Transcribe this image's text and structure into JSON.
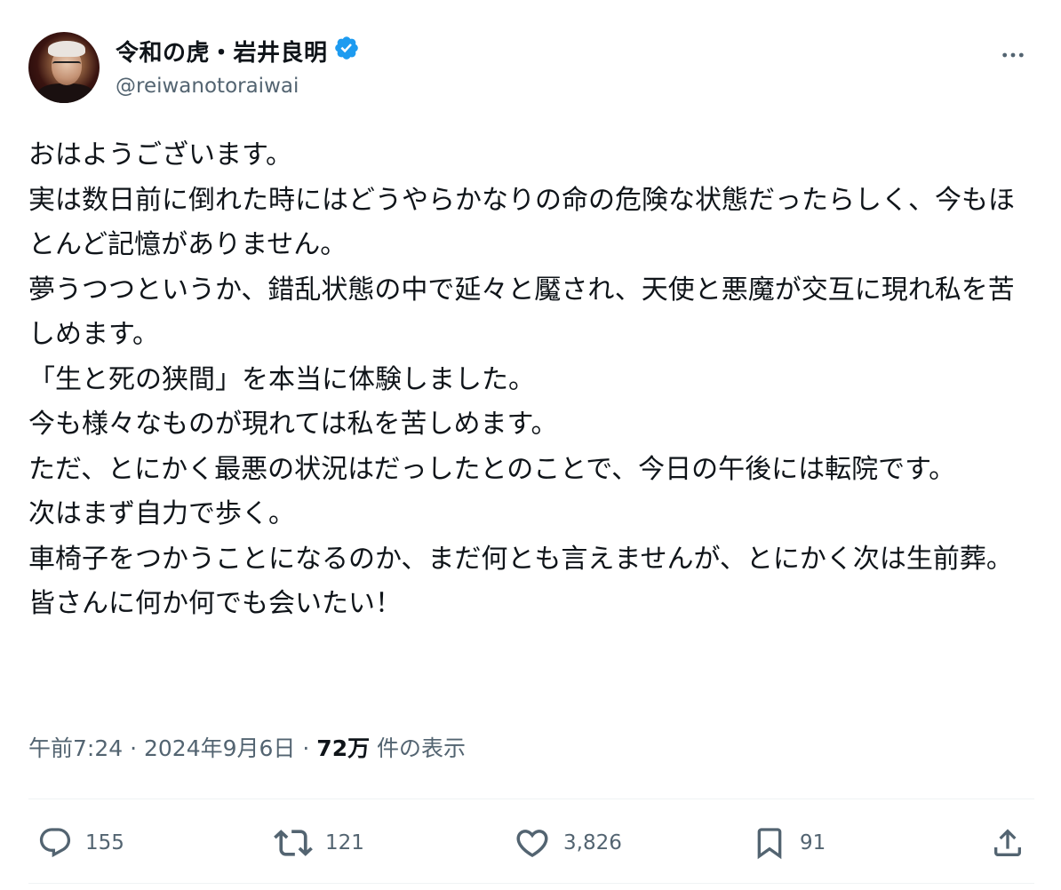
{
  "author": {
    "display_name": "令和の虎・岩井良明",
    "handle": "@reiwanotoraiwai",
    "verified": true
  },
  "tweet": {
    "text": "おはようございます。\n実は数日前に倒れた時にはどうやらかなりの命の危険な状態だったらしく、今もほとんど記憶がありません。\n夢うつつというか、錯乱状態の中で延々と魘され、天使と悪魔が交互に現れ私を苦しめます。\n「生と死の狭間」を本当に体験しました。\n今も様々なものが現れては私を苦しめます。\nただ、とにかく最悪の状況はだっしたとのことで、今日の午後には転院です。\n次はまず自力で歩く。\n車椅子をつかうことになるのか、まだ何とも言えませんが、とにかく次は生前葬。\n皆さんに何か何でも会いたい！"
  },
  "meta": {
    "time": "午前7:24",
    "separator": "·",
    "date": "2024年9月6日",
    "views_count": "72万",
    "views_label": "件の表示"
  },
  "actions": {
    "reply_count": "155",
    "retweet_count": "121",
    "like_count": "3,826",
    "bookmark_count": "91"
  },
  "colors": {
    "text": "#0f1419",
    "secondary": "#536471",
    "verified": "#1d9bf0",
    "divider": "#eff3f4"
  },
  "icons": [
    "more-icon",
    "verified-badge-icon",
    "reply-icon",
    "retweet-icon",
    "like-icon",
    "bookmark-icon",
    "share-icon"
  ]
}
